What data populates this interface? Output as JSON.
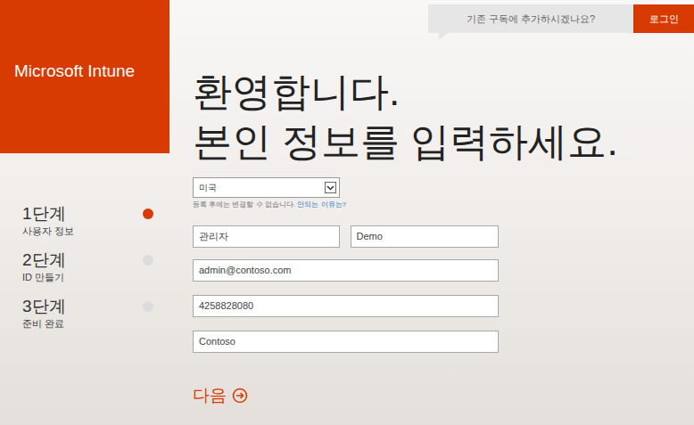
{
  "brand": {
    "title": "Microsoft Intune"
  },
  "top_bar": {
    "prompt": "기존 구독에 추가하시겠나요?",
    "sign_in_button": "로그인"
  },
  "heading": [
    "환영합니다.",
    "본인 정보를 입력하세요."
  ],
  "steps": [
    {
      "title": "1단계",
      "subtitle": "사용자 정보",
      "selected": true
    },
    {
      "title": "2단계",
      "subtitle": "ID 만들기",
      "selected": false
    },
    {
      "title": "3단계",
      "subtitle": "준비 완료",
      "selected": false
    }
  ],
  "form": {
    "country": {
      "value": "미국",
      "note": "등록 후에는 변경할 수 없습니다.",
      "note_link": "안되는 이유는?"
    },
    "name_fields": [
      {
        "name": "first-name",
        "value": "관리자"
      },
      {
        "name": "last-name",
        "value": "Demo"
      }
    ],
    "fields": [
      {
        "name": "email",
        "value": "admin@contoso.com"
      },
      {
        "name": "phone",
        "value": "4258828080"
      },
      {
        "name": "company",
        "value": "Contoso"
      }
    ]
  },
  "next_button": "다음"
}
